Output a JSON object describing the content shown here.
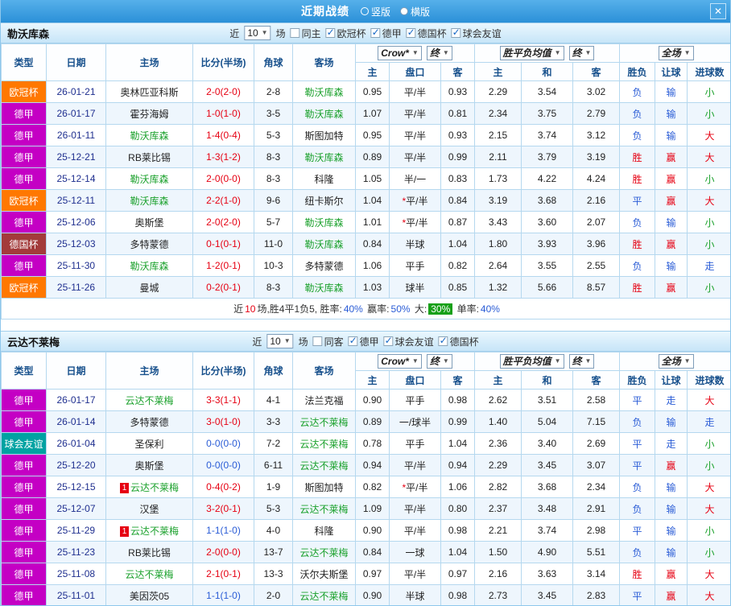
{
  "titlebar": {
    "title": "近期战绩",
    "radios": [
      {
        "label": "竖版",
        "checked": false
      },
      {
        "label": "横版",
        "checked": true
      }
    ],
    "close": "✕"
  },
  "colors": {
    "red": "#e60012",
    "blue": "#2a5cd6",
    "green": "#1ba12c",
    "navy": "#1f2f8f",
    "orange": "#ff7800",
    "purple": "#c400c4",
    "maroon": "#a33b3b",
    "teal": "#00a2a2"
  },
  "table_header": {
    "type": "类型",
    "date": "日期",
    "home": "主场",
    "score": "比分(半场)",
    "corner": "角球",
    "away": "客场",
    "company": "Crow*",
    "final": "终",
    "h": "主",
    "handicap": "盘口",
    "a": "客",
    "avg": "胜平负均值",
    "final2": "终",
    "eh": "主",
    "draw": "和",
    "ea": "客",
    "scope": "全场",
    "result": "胜负",
    "handi_res": "让球",
    "goal_res": "进球数"
  },
  "sections": [
    {
      "team": "勒沃库森",
      "filter": {
        "near": "近",
        "count": "10",
        "games": "场",
        "checks": [
          {
            "label": "同主",
            "checked": false
          },
          {
            "label": "欧冠杯",
            "checked": true
          },
          {
            "label": "德甲",
            "checked": true
          },
          {
            "label": "德国杯",
            "checked": true
          },
          {
            "label": "球会友谊",
            "checked": true
          }
        ]
      },
      "rows": [
        {
          "lg": "欧冠杯",
          "lgc": "orange",
          "dt": "26-01-21",
          "hm": "奥林匹亚科斯",
          "hmc": "",
          "hb": "",
          "sc": "2-0(2-0)",
          "scc": "red",
          "cn": "2-8",
          "aw": "勒沃库森",
          "awc": "green",
          "o": [
            "0.95",
            "平/半",
            "0.93"
          ],
          "e": [
            "2.29",
            "3.54",
            "3.02"
          ],
          "r": [
            "负",
            "blue"
          ],
          "h": [
            "输",
            "blue"
          ],
          "g": [
            "小",
            "green"
          ]
        },
        {
          "lg": "德甲",
          "lgc": "purple",
          "dt": "26-01-17",
          "hm": "霍芬海姆",
          "hmc": "",
          "hb": "",
          "sc": "1-0(1-0)",
          "scc": "red",
          "cn": "3-5",
          "aw": "勒沃库森",
          "awc": "green",
          "o": [
            "1.07",
            "平/半",
            "0.81"
          ],
          "e": [
            "2.34",
            "3.75",
            "2.79"
          ],
          "r": [
            "负",
            "blue"
          ],
          "h": [
            "输",
            "blue"
          ],
          "g": [
            "小",
            "green"
          ]
        },
        {
          "lg": "德甲",
          "lgc": "purple",
          "dt": "26-01-11",
          "hm": "勒沃库森",
          "hmc": "green",
          "hb": "",
          "sc": "1-4(0-4)",
          "scc": "red",
          "cn": "5-3",
          "aw": "斯图加特",
          "awc": "",
          "o": [
            "0.95",
            "平/半",
            "0.93"
          ],
          "e": [
            "2.15",
            "3.74",
            "3.12"
          ],
          "r": [
            "负",
            "blue"
          ],
          "h": [
            "输",
            "blue"
          ],
          "g": [
            "大",
            "red"
          ]
        },
        {
          "lg": "德甲",
          "lgc": "purple",
          "dt": "25-12-21",
          "hm": "RB莱比锡",
          "hmc": "",
          "hb": "",
          "sc": "1-3(1-2)",
          "scc": "red",
          "cn": "8-3",
          "aw": "勒沃库森",
          "awc": "green",
          "o": [
            "0.89",
            "平/半",
            "0.99"
          ],
          "e": [
            "2.11",
            "3.79",
            "3.19"
          ],
          "r": [
            "胜",
            "red"
          ],
          "h": [
            "赢",
            "red"
          ],
          "g": [
            "大",
            "red"
          ]
        },
        {
          "lg": "德甲",
          "lgc": "purple",
          "dt": "25-12-14",
          "hm": "勒沃库森",
          "hmc": "green",
          "hb": "",
          "sc": "2-0(0-0)",
          "scc": "red",
          "cn": "8-3",
          "aw": "科隆",
          "awc": "",
          "o": [
            "1.05",
            "半/一",
            "0.83"
          ],
          "e": [
            "1.73",
            "4.22",
            "4.24"
          ],
          "r": [
            "胜",
            "red"
          ],
          "h": [
            "赢",
            "red"
          ],
          "g": [
            "小",
            "green"
          ]
        },
        {
          "lg": "欧冠杯",
          "lgc": "orange",
          "dt": "25-12-11",
          "hm": "勒沃库森",
          "hmc": "green",
          "hb": "",
          "sc": "2-2(1-0)",
          "scc": "red",
          "cn": "9-6",
          "aw": "纽卡斯尔",
          "awc": "",
          "o": [
            "1.04",
            "*平/半",
            "0.84"
          ],
          "e": [
            "3.19",
            "3.68",
            "2.16"
          ],
          "r": [
            "平",
            "blue"
          ],
          "h": [
            "赢",
            "red"
          ],
          "g": [
            "大",
            "red"
          ]
        },
        {
          "lg": "德甲",
          "lgc": "purple",
          "dt": "25-12-06",
          "hm": "奥斯堡",
          "hmc": "",
          "hb": "",
          "sc": "2-0(2-0)",
          "scc": "red",
          "cn": "5-7",
          "aw": "勒沃库森",
          "awc": "green",
          "o": [
            "1.01",
            "*平/半",
            "0.87"
          ],
          "e": [
            "3.43",
            "3.60",
            "2.07"
          ],
          "r": [
            "负",
            "blue"
          ],
          "h": [
            "输",
            "blue"
          ],
          "g": [
            "小",
            "green"
          ]
        },
        {
          "lg": "德国杯",
          "lgc": "maroon",
          "dt": "25-12-03",
          "hm": "多特蒙德",
          "hmc": "",
          "hb": "",
          "sc": "0-1(0-1)",
          "scc": "red",
          "cn": "11-0",
          "aw": "勒沃库森",
          "awc": "green",
          "o": [
            "0.84",
            "半球",
            "1.04"
          ],
          "e": [
            "1.80",
            "3.93",
            "3.96"
          ],
          "r": [
            "胜",
            "red"
          ],
          "h": [
            "赢",
            "red"
          ],
          "g": [
            "小",
            "green"
          ]
        },
        {
          "lg": "德甲",
          "lgc": "purple",
          "dt": "25-11-30",
          "hm": "勒沃库森",
          "hmc": "green",
          "hb": "",
          "sc": "1-2(0-1)",
          "scc": "red",
          "cn": "10-3",
          "aw": "多特蒙德",
          "awc": "",
          "o": [
            "1.06",
            "平手",
            "0.82"
          ],
          "e": [
            "2.64",
            "3.55",
            "2.55"
          ],
          "r": [
            "负",
            "blue"
          ],
          "h": [
            "输",
            "blue"
          ],
          "g": [
            "走",
            "blue"
          ]
        },
        {
          "lg": "欧冠杯",
          "lgc": "orange",
          "dt": "25-11-26",
          "hm": "曼城",
          "hmc": "",
          "hb": "",
          "sc": "0-2(0-1)",
          "scc": "red",
          "cn": "8-3",
          "aw": "勒沃库森",
          "awc": "green",
          "o": [
            "1.03",
            "球半",
            "0.85"
          ],
          "e": [
            "1.32",
            "5.66",
            "8.57"
          ],
          "r": [
            "胜",
            "red"
          ],
          "h": [
            "赢",
            "red"
          ],
          "g": [
            "小",
            "green"
          ]
        }
      ],
      "summary": [
        {
          "t": "近"
        },
        {
          "t": "10",
          "c": "#e60012"
        },
        {
          "t": "场,胜4平1负5, 胜率:"
        },
        {
          "t": "40%",
          "c": "#2a5cd6"
        },
        {
          "t": " 赢率:"
        },
        {
          "t": "50%",
          "c": "#2a5cd6"
        },
        {
          "t": " 大:"
        },
        {
          "t": "30%",
          "bg": "#18a018"
        },
        {
          "t": " 单率:"
        },
        {
          "t": "40%",
          "c": "#2a5cd6"
        }
      ]
    },
    {
      "team": "云达不莱梅",
      "filter": {
        "near": "近",
        "count": "10",
        "games": "场",
        "checks": [
          {
            "label": "同客",
            "checked": false
          },
          {
            "label": "德甲",
            "checked": true
          },
          {
            "label": "球会友谊",
            "checked": true
          },
          {
            "label": "德国杯",
            "checked": true
          }
        ]
      },
      "rows": [
        {
          "lg": "德甲",
          "lgc": "purple",
          "dt": "26-01-17",
          "hm": "云达不莱梅",
          "hmc": "green",
          "hb": "",
          "sc": "3-3(1-1)",
          "scc": "red",
          "cn": "4-1",
          "aw": "法兰克福",
          "awc": "",
          "o": [
            "0.90",
            "平手",
            "0.98"
          ],
          "e": [
            "2.62",
            "3.51",
            "2.58"
          ],
          "r": [
            "平",
            "blue"
          ],
          "h": [
            "走",
            "blue"
          ],
          "g": [
            "大",
            "red"
          ]
        },
        {
          "lg": "德甲",
          "lgc": "purple",
          "dt": "26-01-14",
          "hm": "多特蒙德",
          "hmc": "",
          "hb": "",
          "sc": "3-0(1-0)",
          "scc": "red",
          "cn": "3-3",
          "aw": "云达不莱梅",
          "awc": "green",
          "o": [
            "0.89",
            "一/球半",
            "0.99"
          ],
          "e": [
            "1.40",
            "5.04",
            "7.15"
          ],
          "r": [
            "负",
            "blue"
          ],
          "h": [
            "输",
            "blue"
          ],
          "g": [
            "走",
            "blue"
          ]
        },
        {
          "lg": "球会友谊",
          "lgc": "teal",
          "dt": "26-01-04",
          "hm": "圣保利",
          "hmc": "",
          "hb": "",
          "sc": "0-0(0-0)",
          "scc": "blue",
          "cn": "7-2",
          "aw": "云达不莱梅",
          "awc": "green",
          "o": [
            "0.78",
            "平手",
            "1.04"
          ],
          "e": [
            "2.36",
            "3.40",
            "2.69"
          ],
          "r": [
            "平",
            "blue"
          ],
          "h": [
            "走",
            "blue"
          ],
          "g": [
            "小",
            "green"
          ]
        },
        {
          "lg": "德甲",
          "lgc": "purple",
          "dt": "25-12-20",
          "hm": "奥斯堡",
          "hmc": "",
          "hb": "",
          "sc": "0-0(0-0)",
          "scc": "blue",
          "cn": "6-11",
          "aw": "云达不莱梅",
          "awc": "green",
          "o": [
            "0.94",
            "平/半",
            "0.94"
          ],
          "e": [
            "2.29",
            "3.45",
            "3.07"
          ],
          "r": [
            "平",
            "blue"
          ],
          "h": [
            "赢",
            "red"
          ],
          "g": [
            "小",
            "green"
          ]
        },
        {
          "lg": "德甲",
          "lgc": "purple",
          "dt": "25-12-15",
          "hm": "云达不莱梅",
          "hmc": "green",
          "hb": "1",
          "sc": "0-4(0-2)",
          "scc": "red",
          "cn": "1-9",
          "aw": "斯图加特",
          "awc": "",
          "o": [
            "0.82",
            "*平/半",
            "1.06"
          ],
          "e": [
            "2.82",
            "3.68",
            "2.34"
          ],
          "r": [
            "负",
            "blue"
          ],
          "h": [
            "输",
            "blue"
          ],
          "g": [
            "大",
            "red"
          ]
        },
        {
          "lg": "德甲",
          "lgc": "purple",
          "dt": "25-12-07",
          "hm": "汉堡",
          "hmc": "",
          "hb": "",
          "sc": "3-2(0-1)",
          "scc": "red",
          "cn": "5-3",
          "aw": "云达不莱梅",
          "awc": "green",
          "o": [
            "1.09",
            "平/半",
            "0.80"
          ],
          "e": [
            "2.37",
            "3.48",
            "2.91"
          ],
          "r": [
            "负",
            "blue"
          ],
          "h": [
            "输",
            "blue"
          ],
          "g": [
            "大",
            "red"
          ]
        },
        {
          "lg": "德甲",
          "lgc": "purple",
          "dt": "25-11-29",
          "hm": "云达不莱梅",
          "hmc": "green",
          "hb": "1",
          "sc": "1-1(1-0)",
          "scc": "blue",
          "cn": "4-0",
          "aw": "科隆",
          "awc": "",
          "o": [
            "0.90",
            "平/半",
            "0.98"
          ],
          "e": [
            "2.21",
            "3.74",
            "2.98"
          ],
          "r": [
            "平",
            "blue"
          ],
          "h": [
            "输",
            "blue"
          ],
          "g": [
            "小",
            "green"
          ]
        },
        {
          "lg": "德甲",
          "lgc": "purple",
          "dt": "25-11-23",
          "hm": "RB莱比锡",
          "hmc": "",
          "hb": "",
          "sc": "2-0(0-0)",
          "scc": "red",
          "cn": "13-7",
          "aw": "云达不莱梅",
          "awc": "green",
          "o": [
            "0.84",
            "一球",
            "1.04"
          ],
          "e": [
            "1.50",
            "4.90",
            "5.51"
          ],
          "r": [
            "负",
            "blue"
          ],
          "h": [
            "输",
            "blue"
          ],
          "g": [
            "小",
            "green"
          ]
        },
        {
          "lg": "德甲",
          "lgc": "purple",
          "dt": "25-11-08",
          "hm": "云达不莱梅",
          "hmc": "green",
          "hb": "",
          "sc": "2-1(0-1)",
          "scc": "red",
          "cn": "13-3",
          "aw": "沃尔夫斯堡",
          "awc": "",
          "o": [
            "0.97",
            "平/半",
            "0.97"
          ],
          "e": [
            "2.16",
            "3.63",
            "3.14"
          ],
          "r": [
            "胜",
            "red"
          ],
          "h": [
            "赢",
            "red"
          ],
          "g": [
            "大",
            "red"
          ]
        },
        {
          "lg": "德甲",
          "lgc": "purple",
          "dt": "25-11-01",
          "hm": "美因茨05",
          "hmc": "",
          "hb": "",
          "sc": "1-1(1-0)",
          "scc": "blue",
          "cn": "2-0",
          "aw": "云达不莱梅",
          "awc": "green",
          "o": [
            "0.90",
            "半球",
            "0.98"
          ],
          "e": [
            "2.73",
            "3.45",
            "2.83"
          ],
          "r": [
            "平",
            "blue"
          ],
          "h": [
            "赢",
            "red"
          ],
          "g": [
            "大",
            "red"
          ]
        }
      ]
    }
  ]
}
